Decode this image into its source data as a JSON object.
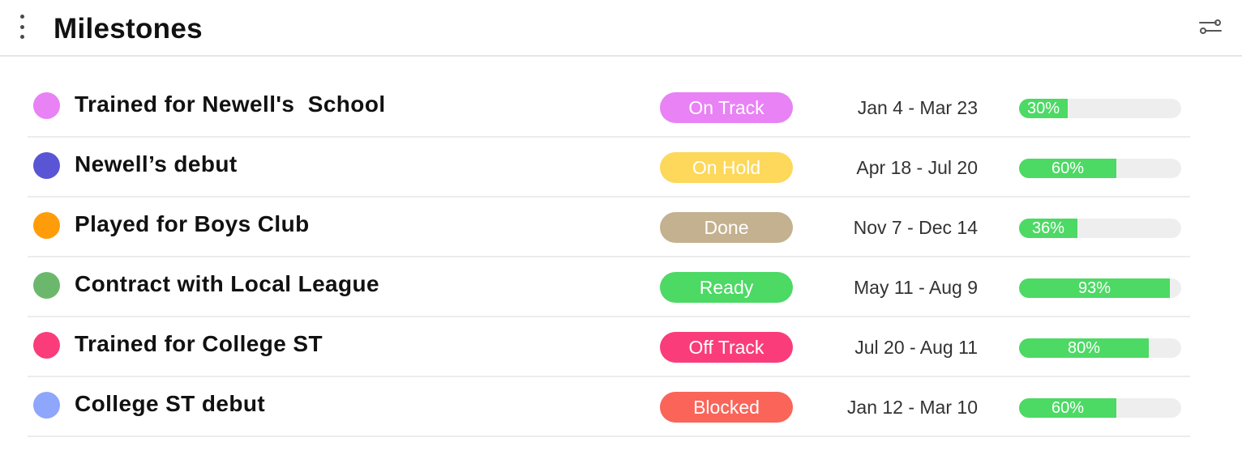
{
  "header": {
    "title": "Milestones",
    "menu_icon": "vertical-dots-icon",
    "filter_icon": "sliders-icon"
  },
  "colors": {
    "progress_fill": "#4cd964",
    "progress_track": "#eeeeee"
  },
  "milestones": [
    {
      "name": "Trained for Newell's  School",
      "dot_color": "#e882f5",
      "status": "On Track",
      "status_color": "#e882f5",
      "dates": "Jan 4 - Mar 23",
      "progress": 30,
      "progress_label": "30%"
    },
    {
      "name": "Newell’s debut",
      "dot_color": "#5a55d5",
      "status": "On Hold",
      "status_color": "#fdd85a",
      "dates": "Apr 18 - Jul 20",
      "progress": 60,
      "progress_label": "60%"
    },
    {
      "name": "Played for Boys Club",
      "dot_color": "#ff9c0a",
      "status": "Done",
      "status_color": "#c4b18f",
      "dates": "Nov 7 - Dec 14",
      "progress": 36,
      "progress_label": "36%"
    },
    {
      "name": "Contract with Local League",
      "dot_color": "#6bb86d",
      "status": "Ready",
      "status_color": "#4cd964",
      "dates": "May 11 - Aug 9",
      "progress": 93,
      "progress_label": "93%"
    },
    {
      "name": "Trained for College ST",
      "dot_color": "#fa3d7a",
      "status": "Off Track",
      "status_color": "#fa3d7a",
      "dates": "Jul 20 - Aug 11",
      "progress": 80,
      "progress_label": "80%"
    },
    {
      "name": "College ST debut",
      "dot_color": "#8ea6fb",
      "status": "Blocked",
      "status_color": "#fa6459",
      "dates": "Jan 12 - Mar 10",
      "progress": 60,
      "progress_label": "60%"
    }
  ]
}
